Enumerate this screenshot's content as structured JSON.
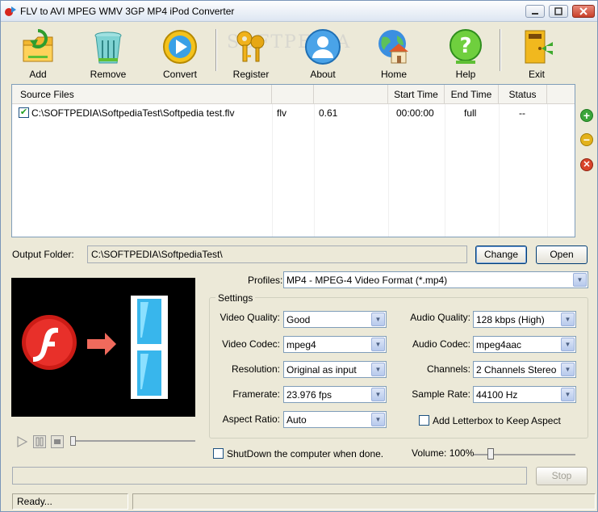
{
  "window": {
    "title": "FLV to AVI MPEG WMV 3GP MP4 iPod Converter",
    "watermark": "SOFTPEDIA",
    "watermark_url": "www.softpedia.com"
  },
  "toolbar": {
    "add": "Add",
    "remove": "Remove",
    "convert": "Convert",
    "register": "Register",
    "about": "About",
    "home": "Home",
    "help": "Help",
    "exit": "Exit"
  },
  "file_list": {
    "headers": [
      "Source Files",
      "",
      "",
      "Start Time",
      "End Time",
      "Status"
    ],
    "rows": [
      {
        "checked": true,
        "source": "C:\\SOFTPEDIA\\SoftpediaTest\\Softpedia test.flv",
        "format": "flv",
        "size": "0.61",
        "start": "00:00:00",
        "end": "full",
        "status": "--"
      }
    ]
  },
  "output": {
    "label": "Output Folder:",
    "value": "C:\\SOFTPEDIA\\SoftpediaTest\\",
    "change": "Change",
    "open": "Open"
  },
  "profile": {
    "label": "Profiles:",
    "value": "MP4 - MPEG-4 Video Format (*.mp4)"
  },
  "settings": {
    "legend": "Settings",
    "video_quality_label": "Video Quality:",
    "video_quality": "Good",
    "video_codec_label": "Video Codec:",
    "video_codec": "mpeg4",
    "resolution_label": "Resolution:",
    "resolution": "Original as input",
    "framerate_label": "Framerate:",
    "framerate": "23.976 fps",
    "aspect_ratio_label": "Aspect Ratio:",
    "aspect_ratio": "Auto",
    "audio_quality_label": "Audio Quality:",
    "audio_quality": "128 kbps (High)",
    "audio_codec_label": "Audio Codec:",
    "audio_codec": "mpeg4aac",
    "channels_label": "Channels:",
    "channels": "2 Channels Stereo",
    "sample_rate_label": "Sample Rate:",
    "sample_rate": "44100 Hz",
    "letterbox_label": "Add Letterbox to Keep Aspect",
    "letterbox_checked": false
  },
  "shutdown": {
    "label": "ShutDown the computer when done.",
    "checked": false
  },
  "volume": {
    "label": "Volume: 100%",
    "level": 1.0
  },
  "progress": {
    "value": 0,
    "stop": "Stop"
  },
  "status": {
    "text": "Ready..."
  },
  "colors": {
    "window_bg": "#ece9d8",
    "accent": "#003c74",
    "add_green": "#3aa53a",
    "remove_yellow": "#e3b21b",
    "delete_red": "#d9442a"
  }
}
